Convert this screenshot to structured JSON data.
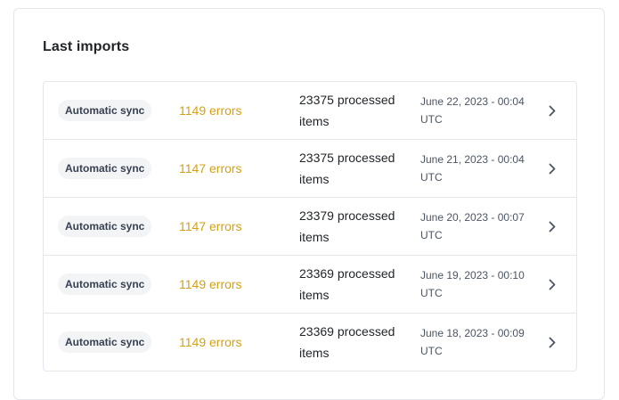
{
  "card": {
    "title": "Last imports"
  },
  "imports": [
    {
      "type": "Automatic sync",
      "errors": "1149 errors",
      "processed": "23375 processed items",
      "date": "June 22, 2023 - 00:04 UTC"
    },
    {
      "type": "Automatic sync",
      "errors": "1147 errors",
      "processed": "23375 processed items",
      "date": "June 21, 2023 - 00:04 UTC"
    },
    {
      "type": "Automatic sync",
      "errors": "1147 errors",
      "processed": "23379 processed items",
      "date": "June 20, 2023 - 00:07 UTC"
    },
    {
      "type": "Automatic sync",
      "errors": "1149 errors",
      "processed": "23369 processed items",
      "date": "June 19, 2023 - 00:10 UTC"
    },
    {
      "type": "Automatic sync",
      "errors": "1149 errors",
      "processed": "23369 processed items",
      "date": "June 18, 2023 - 00:09 UTC"
    }
  ],
  "colors": {
    "errors_text": "#d4a017",
    "badge_bg": "#f3f4f6",
    "border": "#e5e7eb"
  },
  "icons": {
    "row_action": "chevron-right-icon"
  }
}
